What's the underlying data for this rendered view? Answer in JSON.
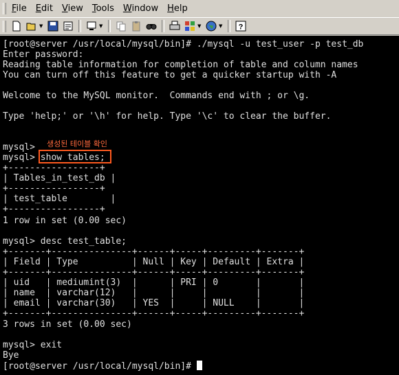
{
  "menu": {
    "items": [
      {
        "underline": "F",
        "rest": "ile"
      },
      {
        "underline": "E",
        "rest": "dit"
      },
      {
        "underline": "V",
        "rest": "iew"
      },
      {
        "underline": "T",
        "rest": "ools"
      },
      {
        "underline": "W",
        "rest": "indow"
      },
      {
        "underline": "H",
        "rest": "elp"
      }
    ]
  },
  "toolbar": {
    "icons": [
      "new-icon",
      "open-icon",
      "save-icon",
      "properties-icon",
      "copy-icon",
      "paste-icon",
      "find-icon",
      "print-icon",
      "security-icon",
      "globe-icon",
      "help-icon"
    ]
  },
  "terminal": {
    "lines": [
      "[root@server /usr/local/mysql/bin]# ./mysql -u test_user -p test_db",
      "Enter password:",
      "Reading table information for completion of table and column names",
      "You can turn off this feature to get a quicker startup with -A",
      "",
      "Welcome to the MySQL monitor.  Commands end with ; or \\g.",
      "",
      "Type 'help;' or '\\h' for help. Type '\\c' to clear the buffer.",
      "",
      "",
      "mysql>",
      "mysql> show tables;",
      "+-----------------+",
      "| Tables_in_test_db |",
      "+-----------------+",
      "| test_table        |",
      "+-----------------+",
      "1 row in set (0.00 sec)",
      "",
      "mysql> desc test_table;",
      "+-------+---------------+------+-----+---------+-------+",
      "| Field | Type          | Null | Key | Default | Extra |",
      "+-------+---------------+------+-----+---------+-------+",
      "| uid   | mediumint(3)  |      | PRI | 0       |       |",
      "| name  | varchar(12)   |      |     |         |       |",
      "| email | varchar(30)   | YES  |     | NULL    |       |",
      "+-------+---------------+------+-----+---------+-------+",
      "3 rows in set (0.00 sec)",
      "",
      "mysql> exit",
      "Bye",
      "[root@server /usr/local/mysql/bin]# "
    ],
    "annotation": "생성된 테이블 확인",
    "highlight_color": "#ff5a1f"
  }
}
